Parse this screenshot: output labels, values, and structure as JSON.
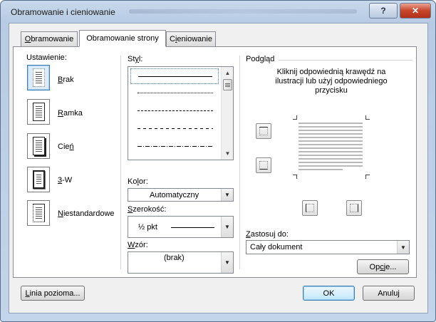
{
  "window": {
    "title": "Obramowanie i cieniowanie",
    "help_label": "?",
    "close_label": "✕"
  },
  "tabs": [
    {
      "label_pre": "",
      "label_u": "O",
      "label_post": "bramowanie",
      "active": false
    },
    {
      "label_pre": "Obramowanie strony",
      "label_u": "",
      "label_post": "",
      "active": true
    },
    {
      "label_pre": "C",
      "label_u": "i",
      "label_post": "eniowanie",
      "active": false
    }
  ],
  "setting": {
    "heading": "Ustawienie:",
    "items": [
      {
        "pre": "",
        "u": "B",
        "post": "rak",
        "icon": "no-border-icon"
      },
      {
        "pre": "",
        "u": "R",
        "post": "amka",
        "icon": "box-border-icon"
      },
      {
        "pre": "Cie",
        "u": "ń",
        "post": "",
        "icon": "shadow-border-icon"
      },
      {
        "pre": "",
        "u": "3",
        "post": "-W",
        "icon": "3d-border-icon"
      },
      {
        "pre": "",
        "u": "N",
        "post": "iestandardowe",
        "icon": "custom-border-icon"
      }
    ],
    "selected_index": 0
  },
  "style": {
    "label_pre": "St",
    "label_u": "y",
    "label_post": "l:",
    "options": [
      "solid",
      "dotted",
      "dashed",
      "dash-small",
      "dash-dot"
    ],
    "selected_index": 0
  },
  "color": {
    "label_pre": "Ko",
    "label_u": "l",
    "label_post": "or:",
    "value": "Automatyczny"
  },
  "width": {
    "label_pre": "",
    "label_u": "S",
    "label_post": "zerokość:",
    "value": "½ pkt"
  },
  "art": {
    "label_pre": "",
    "label_u": "W",
    "label_post": "zór:",
    "value": "(brak)"
  },
  "preview": {
    "heading": "Podgląd",
    "instruction": "Kliknij odpowiednią krawędź na ilustracji lub użyj odpowiedniego przycisku"
  },
  "apply_to": {
    "label_pre": "",
    "label_u": "Z",
    "label_post": "astosuj do:",
    "value": "Cały dokument"
  },
  "buttons": {
    "options_pre": "Op",
    "options_u": "c",
    "options_post": "je...",
    "horizontal_line_pre": "",
    "horizontal_line_u": "L",
    "horizontal_line_post": "inia pozioma...",
    "ok": "OK",
    "cancel": "Anuluj"
  }
}
